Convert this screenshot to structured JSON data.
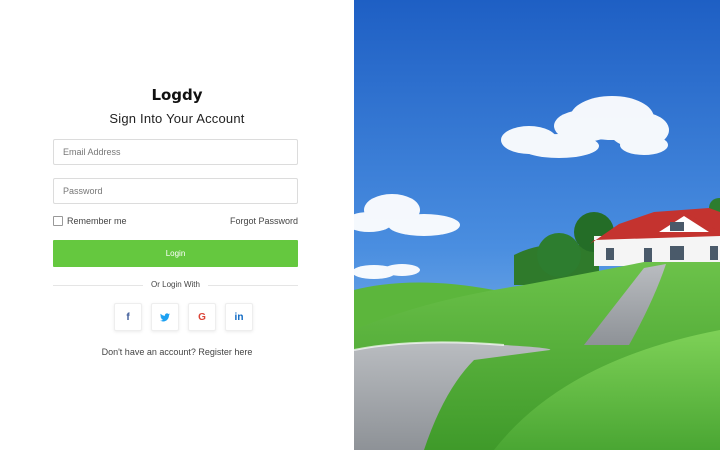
{
  "brand": "Logdy",
  "subtitle": "Sign Into Your Account",
  "email": {
    "placeholder": "Email Address",
    "value": ""
  },
  "password": {
    "placeholder": "Password",
    "value": ""
  },
  "remember_label": "Remember me",
  "forgot_label": "Forgot Password",
  "login_label": "Login",
  "divider_text": "Or Login With",
  "socials": [
    {
      "glyph": "f",
      "icon": "facebook-icon",
      "color": "#3b5998"
    },
    {
      "glyph": "♥",
      "icon": "twitter-icon",
      "color": "#1da1f2"
    },
    {
      "glyph": "G",
      "icon": "google-icon",
      "color": "#db4437"
    },
    {
      "glyph": "in",
      "icon": "linkedin-icon",
      "color": "#0a66c2"
    }
  ],
  "register": {
    "prompt": "Don't have an account?",
    "link": "Register here"
  },
  "colors": {
    "accent": "#65c83f"
  }
}
